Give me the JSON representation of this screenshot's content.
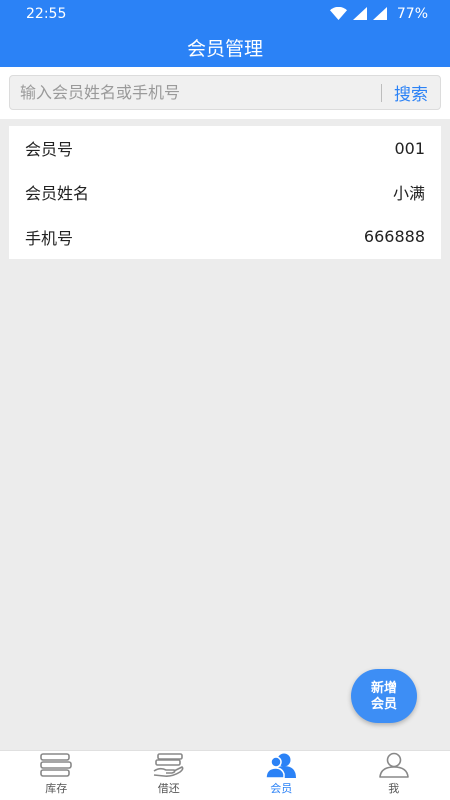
{
  "status_bar": {
    "time": "22:55",
    "battery": "77%",
    "icons": [
      "wifi-icon",
      "signal-icon",
      "signal-icon",
      "battery-text"
    ]
  },
  "app_bar": {
    "title": "会员管理"
  },
  "search": {
    "placeholder": "输入会员姓名或手机号",
    "value": "",
    "button_label": "搜索"
  },
  "member": {
    "rows": [
      {
        "label": "会员号",
        "value": "001"
      },
      {
        "label": "会员姓名",
        "value": "小满"
      },
      {
        "label": "手机号",
        "value": "666888"
      }
    ]
  },
  "fab": {
    "line1": "新增",
    "line2": "会员"
  },
  "bottom_nav": {
    "items": [
      {
        "label": "库存",
        "icon": "books-icon",
        "active": false
      },
      {
        "label": "借还",
        "icon": "hand-book-icon",
        "active": false
      },
      {
        "label": "会员",
        "icon": "member-icon",
        "active": true
      },
      {
        "label": "我",
        "icon": "person-icon",
        "active": false
      }
    ]
  },
  "colors": {
    "primary": "#2b82f6",
    "background": "#ececec",
    "fab": "#3d8ef5"
  }
}
